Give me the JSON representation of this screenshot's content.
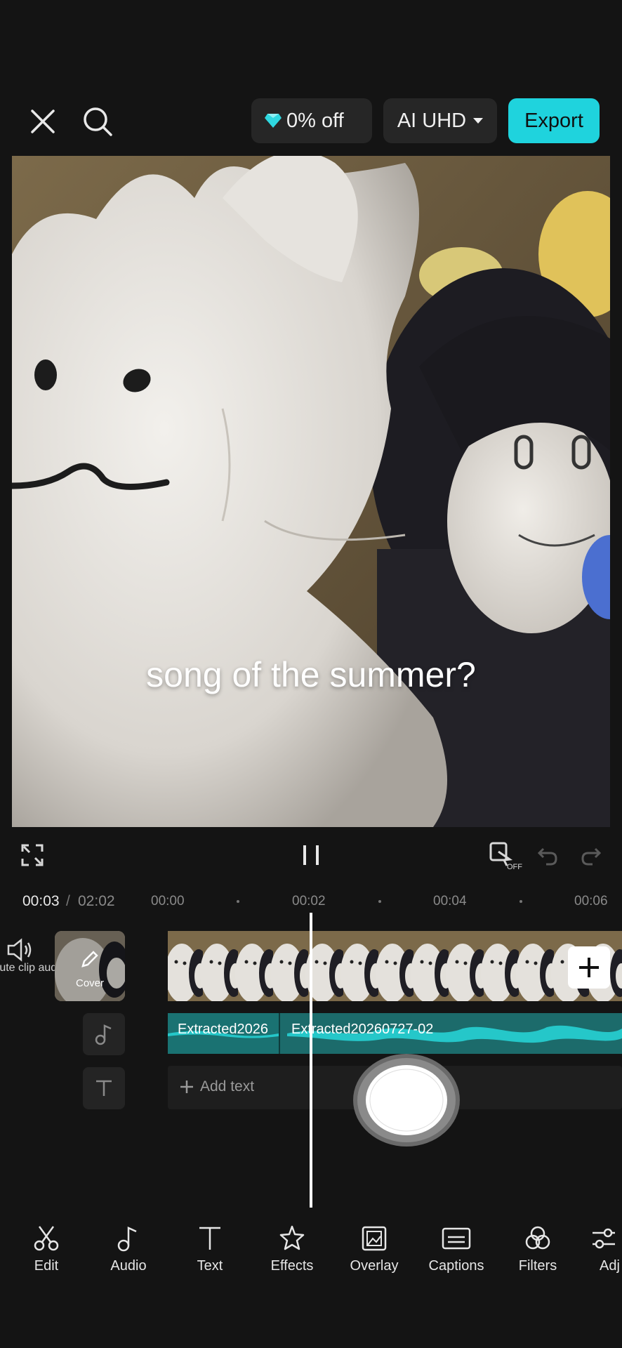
{
  "header": {
    "promo_label": "0% off",
    "quality_label": "AI UHD",
    "export_label": "Export"
  },
  "preview": {
    "caption": "song of the summer?"
  },
  "timeline": {
    "current_time": "00:03",
    "separator": "/",
    "total_time": "02:02",
    "ticks": [
      "00:00",
      "00:02",
      "00:04",
      "00:06"
    ],
    "mute_label": "Mute clip audio",
    "cover_label": "Cover",
    "audio_clips": [
      "Extracted2026",
      "Extracted20260727-02"
    ],
    "add_text_label": "Add text"
  },
  "toolbar": {
    "items": [
      {
        "label": "Edit",
        "icon": "scissors-icon"
      },
      {
        "label": "Audio",
        "icon": "music-note-icon"
      },
      {
        "label": "Text",
        "icon": "text-icon"
      },
      {
        "label": "Effects",
        "icon": "effects-star-icon"
      },
      {
        "label": "Overlay",
        "icon": "overlay-icon"
      },
      {
        "label": "Captions",
        "icon": "captions-icon"
      },
      {
        "label": "Filters",
        "icon": "filters-icon"
      },
      {
        "label": "Adj",
        "icon": "adjust-icon"
      }
    ]
  },
  "colors": {
    "accent": "#1fd3dd",
    "background": "#141414",
    "audio_track": "#1c6b6b"
  }
}
